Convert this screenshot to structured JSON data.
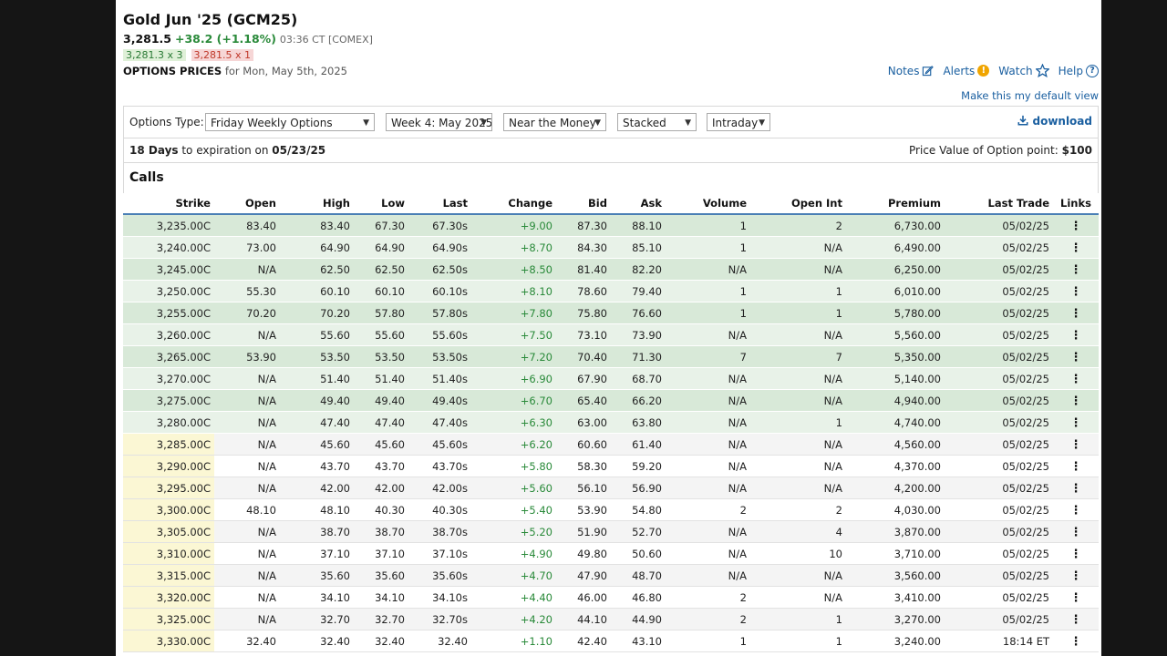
{
  "header": {
    "title": "Gold Jun '25 (GCM25)",
    "last": "3,281.5",
    "change": "+38.2 (+1.18%)",
    "time": "03:36 CT [COMEX]",
    "bid": "3,281.3 x 3",
    "ask": "3,281.5 x 1",
    "options_label": "OPTIONS PRICES",
    "options_date": "for Mon, May 5th, 2025"
  },
  "toplinks": {
    "notes": "Notes",
    "alerts": "Alerts",
    "alerts_badge": "!",
    "watch": "Watch",
    "help": "Help",
    "help_badge": "?"
  },
  "default_view": "Make this my default view",
  "toolbar": {
    "label": "Options Type:",
    "type": "Friday Weekly Options",
    "week": "Week 4: May 2025",
    "range": "Near the Money",
    "view": "Stacked",
    "period": "Intraday",
    "download": "download"
  },
  "expiration": {
    "days": "18 Days",
    "text": " to expiration on ",
    "date": "05/23/25",
    "price_value_label": "Price Value of Option point: ",
    "price_value": "$100"
  },
  "section": "Calls",
  "columns": [
    "Strike",
    "Open",
    "High",
    "Low",
    "Last",
    "Change",
    "Bid",
    "Ask",
    "Volume",
    "Open Int",
    "Premium",
    "Last Trade",
    "Links"
  ],
  "rows": [
    [
      "3,235.00C",
      "83.40",
      "83.40",
      "67.30",
      "67.30s",
      "+9.00",
      "87.30",
      "88.10",
      "1",
      "2",
      "6,730.00",
      "05/02/25"
    ],
    [
      "3,240.00C",
      "73.00",
      "64.90",
      "64.90",
      "64.90s",
      "+8.70",
      "84.30",
      "85.10",
      "1",
      "N/A",
      "6,490.00",
      "05/02/25"
    ],
    [
      "3,245.00C",
      "N/A",
      "62.50",
      "62.50",
      "62.50s",
      "+8.50",
      "81.40",
      "82.20",
      "N/A",
      "N/A",
      "6,250.00",
      "05/02/25"
    ],
    [
      "3,250.00C",
      "55.30",
      "60.10",
      "60.10",
      "60.10s",
      "+8.10",
      "78.60",
      "79.40",
      "1",
      "1",
      "6,010.00",
      "05/02/25"
    ],
    [
      "3,255.00C",
      "70.20",
      "70.20",
      "57.80",
      "57.80s",
      "+7.80",
      "75.80",
      "76.60",
      "1",
      "1",
      "5,780.00",
      "05/02/25"
    ],
    [
      "3,260.00C",
      "N/A",
      "55.60",
      "55.60",
      "55.60s",
      "+7.50",
      "73.10",
      "73.90",
      "N/A",
      "N/A",
      "5,560.00",
      "05/02/25"
    ],
    [
      "3,265.00C",
      "53.90",
      "53.50",
      "53.50",
      "53.50s",
      "+7.20",
      "70.40",
      "71.30",
      "7",
      "7",
      "5,350.00",
      "05/02/25"
    ],
    [
      "3,270.00C",
      "N/A",
      "51.40",
      "51.40",
      "51.40s",
      "+6.90",
      "67.90",
      "68.70",
      "N/A",
      "N/A",
      "5,140.00",
      "05/02/25"
    ],
    [
      "3,275.00C",
      "N/A",
      "49.40",
      "49.40",
      "49.40s",
      "+6.70",
      "65.40",
      "66.20",
      "N/A",
      "N/A",
      "4,940.00",
      "05/02/25"
    ],
    [
      "3,280.00C",
      "N/A",
      "47.40",
      "47.40",
      "47.40s",
      "+6.30",
      "63.00",
      "63.80",
      "N/A",
      "1",
      "4,740.00",
      "05/02/25"
    ],
    [
      "3,285.00C",
      "N/A",
      "45.60",
      "45.60",
      "45.60s",
      "+6.20",
      "60.60",
      "61.40",
      "N/A",
      "N/A",
      "4,560.00",
      "05/02/25"
    ],
    [
      "3,290.00C",
      "N/A",
      "43.70",
      "43.70",
      "43.70s",
      "+5.80",
      "58.30",
      "59.20",
      "N/A",
      "N/A",
      "4,370.00",
      "05/02/25"
    ],
    [
      "3,295.00C",
      "N/A",
      "42.00",
      "42.00",
      "42.00s",
      "+5.60",
      "56.10",
      "56.90",
      "N/A",
      "N/A",
      "4,200.00",
      "05/02/25"
    ],
    [
      "3,300.00C",
      "48.10",
      "48.10",
      "40.30",
      "40.30s",
      "+5.40",
      "53.90",
      "54.80",
      "2",
      "2",
      "4,030.00",
      "05/02/25"
    ],
    [
      "3,305.00C",
      "N/A",
      "38.70",
      "38.70",
      "38.70s",
      "+5.20",
      "51.90",
      "52.70",
      "N/A",
      "4",
      "3,870.00",
      "05/02/25"
    ],
    [
      "3,310.00C",
      "N/A",
      "37.10",
      "37.10",
      "37.10s",
      "+4.90",
      "49.80",
      "50.60",
      "N/A",
      "10",
      "3,710.00",
      "05/02/25"
    ],
    [
      "3,315.00C",
      "N/A",
      "35.60",
      "35.60",
      "35.60s",
      "+4.70",
      "47.90",
      "48.70",
      "N/A",
      "N/A",
      "3,560.00",
      "05/02/25"
    ],
    [
      "3,320.00C",
      "N/A",
      "34.10",
      "34.10",
      "34.10s",
      "+4.40",
      "46.00",
      "46.80",
      "2",
      "N/A",
      "3,410.00",
      "05/02/25"
    ],
    [
      "3,325.00C",
      "N/A",
      "32.70",
      "32.70",
      "32.70s",
      "+4.20",
      "44.10",
      "44.90",
      "2",
      "1",
      "3,270.00",
      "05/02/25"
    ],
    [
      "3,330.00C",
      "32.40",
      "32.40",
      "32.40",
      "32.40",
      "+1.10",
      "42.40",
      "43.10",
      "1",
      "1",
      "3,240.00",
      "18:14 ET"
    ]
  ],
  "in_the_money_count": 10,
  "colors": {
    "itm": "#e8f2e8",
    "otm_strike": "#fbf7d4",
    "link": "#1a5fa0",
    "positive": "#2a8a3a"
  }
}
